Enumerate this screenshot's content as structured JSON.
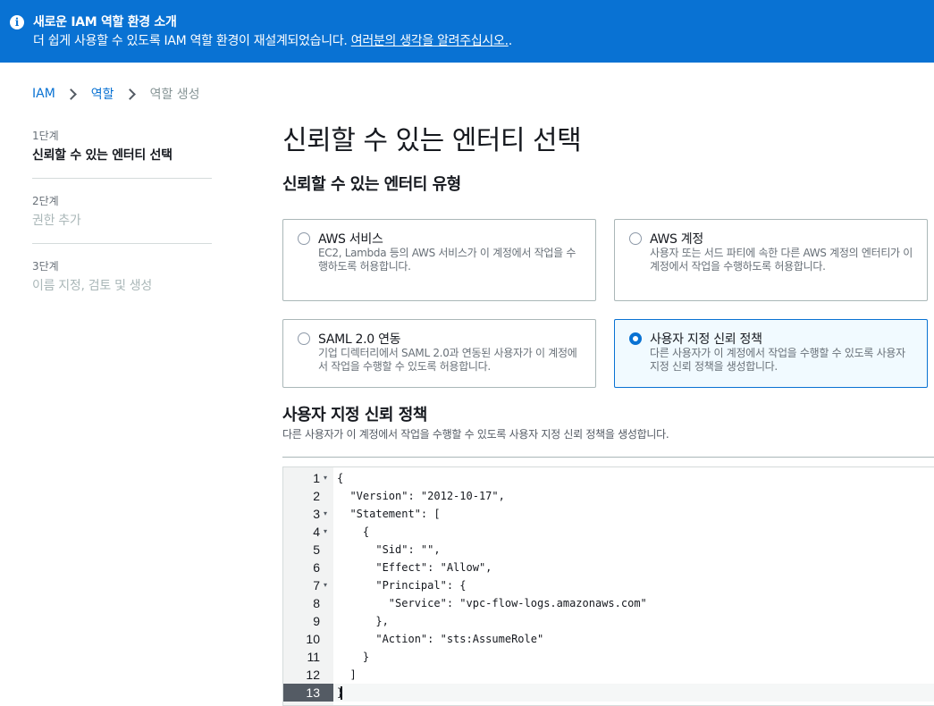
{
  "banner": {
    "icon": "info-icon",
    "title": "새로운 IAM 역할 환경 소개",
    "message": "더 쉽게 사용할 수 있도록 IAM 역할 환경이 재설계되었습니다. ",
    "link": "여러분의 생각을 알려주십시오.",
    "suffix": ".",
    "color": "#0972d3"
  },
  "breadcrumb": {
    "items": [
      "IAM",
      "역할",
      "역할 생성"
    ]
  },
  "steps": [
    {
      "number": "1단계",
      "label": "신뢰할 수 있는 엔터티 선택"
    },
    {
      "number": "2단계",
      "label": "권한 추가"
    },
    {
      "number": "3단계",
      "label": "이름 지정, 검토 및 생성"
    }
  ],
  "page_title": "신뢰할 수 있는 엔터티 선택",
  "entity_section_title": "신뢰할 수 있는 엔터티 유형",
  "entity_types": [
    {
      "title": "AWS 서비스",
      "description": "EC2, Lambda 등의 AWS 서비스가 이 계정에서 작업을 수행하도록 허용합니다.",
      "selected": false
    },
    {
      "title": "AWS 계정",
      "description": "사용자 또는 서드 파티에 속한 다른 AWS 계정의 엔터티가 이 계정에서 작업을 수행하도록 허용합니다.",
      "selected": false
    },
    {
      "title": "SAML 2.0 연동",
      "description": "기업 디렉터리에서 SAML 2.0과 연동된 사용자가 이 계정에서 작업을 수행할 수 있도록 허용합니다.",
      "selected": false
    },
    {
      "title": "사용자 지정 신뢰 정책",
      "description": "다른 사용자가 이 계정에서 작업을 수행할 수 있도록 사용자 지정 신뢰 정책을 생성합니다.",
      "selected": true
    }
  ],
  "policy": {
    "title": "사용자 지정 신뢰 정책",
    "description": "다른 사용자가 이 계정에서 작업을 수행할 수 있도록 사용자 지정 신뢰 정책을 생성합니다.",
    "lines": [
      {
        "num": "1",
        "fold": true,
        "text": "{"
      },
      {
        "num": "2",
        "fold": false,
        "text": "  \"Version\": \"2012-10-17\","
      },
      {
        "num": "3",
        "fold": true,
        "text": "  \"Statement\": ["
      },
      {
        "num": "4",
        "fold": true,
        "text": "    {"
      },
      {
        "num": "5",
        "fold": false,
        "text": "      \"Sid\": \"\","
      },
      {
        "num": "6",
        "fold": false,
        "text": "      \"Effect\": \"Allow\","
      },
      {
        "num": "7",
        "fold": true,
        "text": "      \"Principal\": {"
      },
      {
        "num": "8",
        "fold": false,
        "text": "        \"Service\": \"vpc-flow-logs.amazonaws.com\""
      },
      {
        "num": "9",
        "fold": false,
        "text": "      },"
      },
      {
        "num": "10",
        "fold": false,
        "text": "      \"Action\": \"sts:AssumeRole\""
      },
      {
        "num": "11",
        "fold": false,
        "text": "    }"
      },
      {
        "num": "12",
        "fold": false,
        "text": "  ]"
      },
      {
        "num": "13",
        "fold": false,
        "text": "}",
        "current": true
      }
    ]
  }
}
